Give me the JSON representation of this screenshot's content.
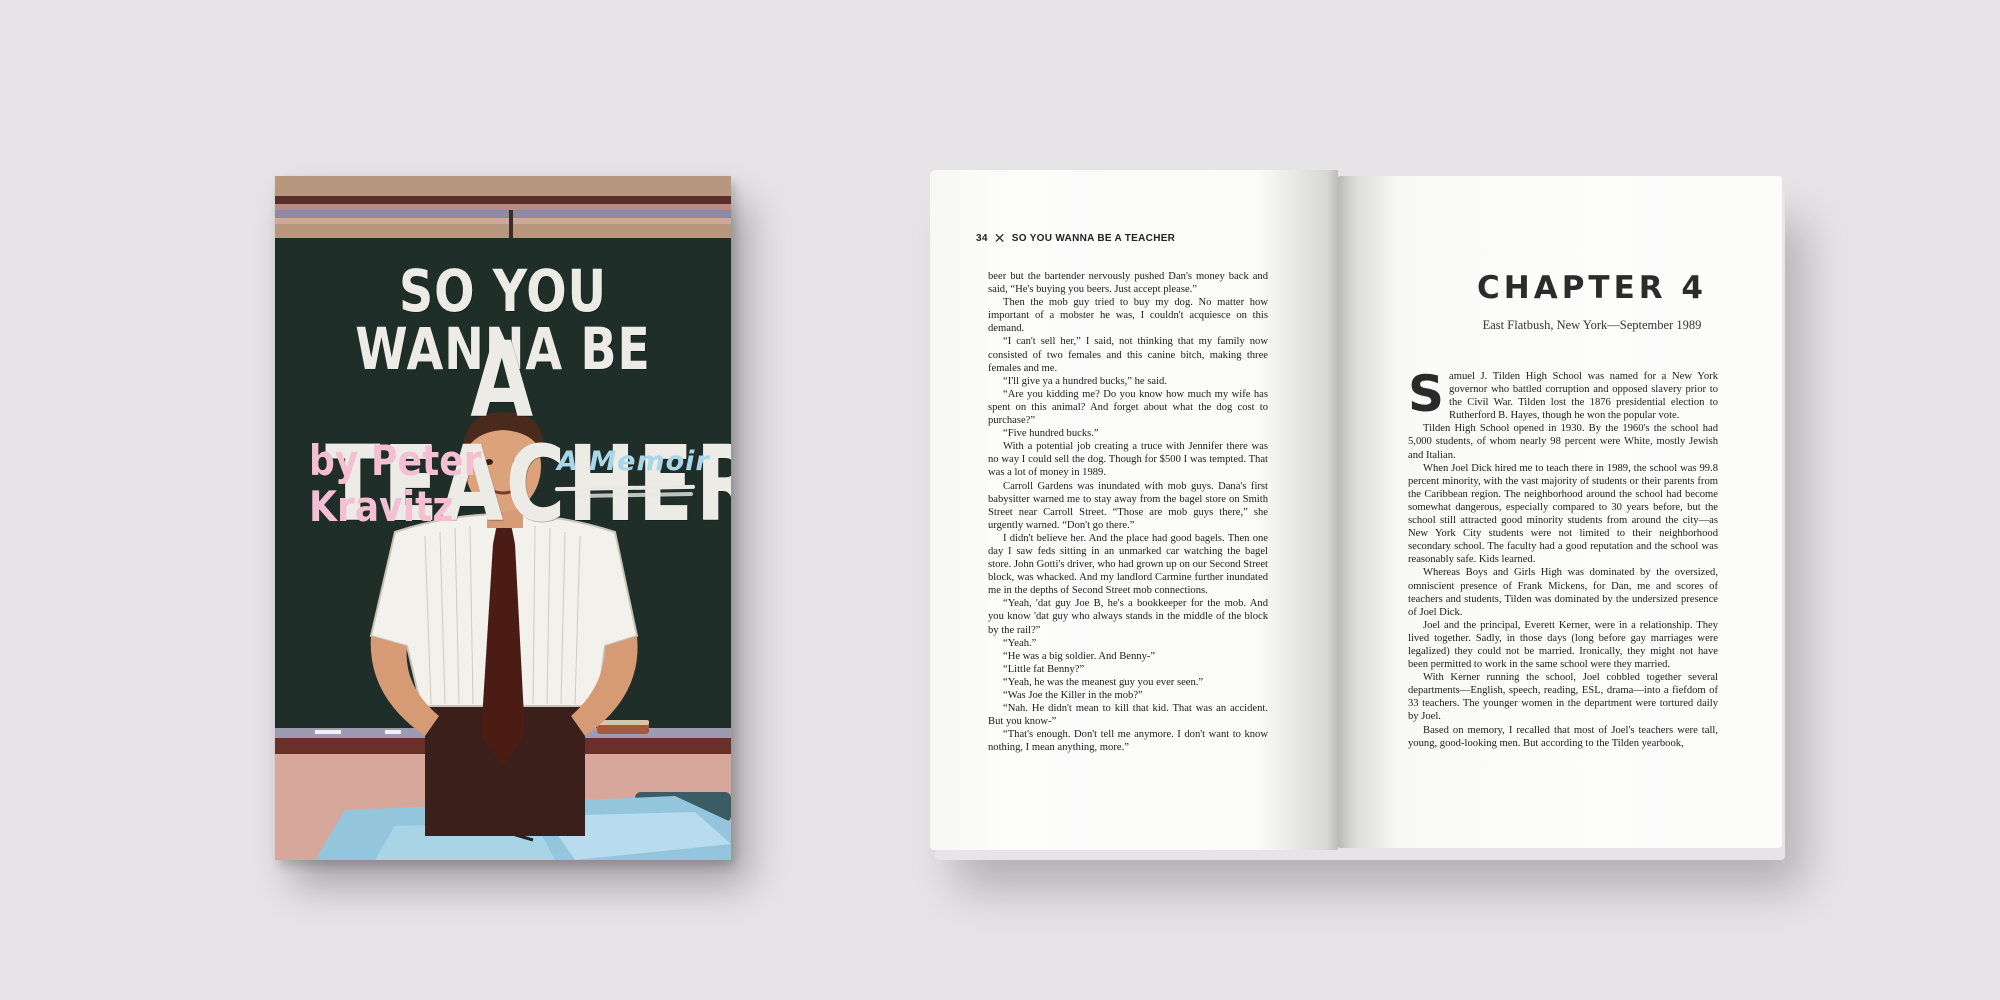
{
  "cover": {
    "title_line1": "SO YOU WANNA BE",
    "title_line2": "A TEACHER",
    "author_line1": "by Peter",
    "author_line2": "Kravitz",
    "subtitle": "A Memoir",
    "colors": {
      "chalkboard": "#1f2e29",
      "author": "#f4bfd2",
      "subtitle": "#a9d6e8",
      "wall": "#d8a79c"
    }
  },
  "left_page": {
    "page_number": "34",
    "running_icon": "crossed-pencils-icon",
    "running_head": "SO YOU WANNA BE A TEACHER",
    "paragraphs": [
      "beer but the bartender nervously pushed Dan's money back and said, “He's buying you beers. Just accept please.”",
      "Then the mob guy tried to buy my dog. No matter how important of a mobster he was, I couldn't acquiesce on this demand.",
      "“I can't sell her,” I said, not thinking that my family now consisted of two females and this canine bitch, making three females and me.",
      "“I'll give ya a hundred bucks,” he said.",
      "“Are you kidding me? Do you know how much my wife has spent on this animal? And forget about what the dog cost to purchase?”",
      "“Five hundred bucks.”",
      "With a potential job creating a truce with Jennifer there was no way I could sell the dog. Though for $500 I was tempted. That was a lot of money in 1989.",
      "Carroll Gardens was inundated with mob guys. Dana's first babysitter warned me to stay away from the bagel store on Smith Street near Carroll Street. “Those are mob guys there,” she urgently warned. “Don't go there.”",
      "I didn't believe her. And the place had good bagels. Then one day I saw feds sitting in an unmarked car watching the bagel store. John Gotti's driver, who had grown up on our Second Street block, was whacked. And my landlord Carmine further inundated me in the depths of Second Street mob connections.",
      "“Yeah, 'dat guy Joe B, he's a bookkeeper for the mob. And you know 'dat guy who always stands in the middle of the block by the rail?”",
      "“Yeah.”",
      "“He was a big soldier. And Benny-”",
      "“Little fat Benny?”",
      "“Yeah, he was the meanest guy you ever seen.”",
      "“Was Joe the Killer in the mob?”",
      "“Nah. He didn't mean to kill that kid. That was an accident. But you know-”",
      "“That's enough. Don't tell me anymore. I don't want to know nothing, I mean anything, more.”"
    ]
  },
  "right_page": {
    "chapter_title": "CHAPTER 4",
    "chapter_subtitle": "East Flatbush, New York—September 1989",
    "drop_cap": "S",
    "first_paragraph": "amuel J. Tilden High School was named for a New York governor who battled corruption and opposed slavery prior to the Civil War. Tilden lost the 1876 presidential election to Rutherford B. Hayes, though he won the popular vote.",
    "paragraphs": [
      "Tilden High School opened in 1930. By the 1960's the school had 5,000 students, of whom nearly 98 percent were White, mostly Jewish and Italian.",
      "When Joel Dick hired me to teach there in 1989, the school was 99.8 percent minority, with the vast majority of students or their parents from the Caribbean region. The neighborhood around the school had become somewhat dangerous, especially compared to 30 years before, but the school still attracted good minority students from around the city—as New York City students were not limited to their neighborhood secondary school. The faculty had a good reputation and the school was reasonably safe. Kids learned.",
      "Whereas Boys and Girls High was dominated by the oversized, omniscient presence of Frank Mickens, for Dan, me and scores of teachers and students, Tilden was dominated by the undersized presence of Joel Dick.",
      "Joel and the principal, Everett Kerner, were in a relationship. They lived together. Sadly, in those days (long before gay marriages were legalized) they could not be married. Ironically, they might not have been permitted to work in the same school were they married.",
      "With Kerner running the school, Joel cobbled together several departments—English, speech, reading, ESL, drama—into a fiefdom of 33 teachers. The younger women in the department were tortured daily by Joel.",
      "Based on memory, I recalled that most of Joel's teachers were tall, young, good-looking men. But according to the Tilden yearbook,"
    ]
  }
}
